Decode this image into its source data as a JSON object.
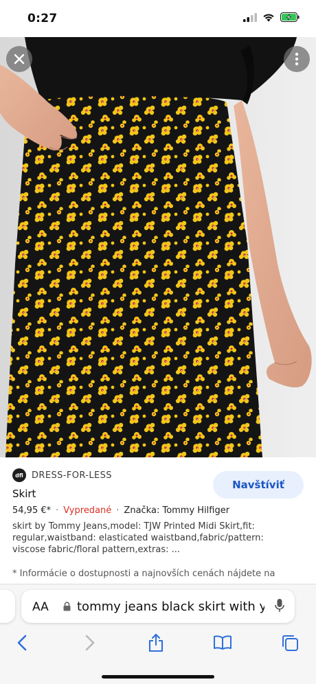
{
  "status_bar": {
    "time": "0:27",
    "icons": [
      "cellular-signal-icon",
      "wifi-icon",
      "battery-charging-icon"
    ]
  },
  "image_viewer": {
    "close_icon": "close-icon",
    "more_icon": "more-vertical-icon",
    "image_alt": "Black midi skirt with yellow floral print"
  },
  "result": {
    "source_logo_text": "dfl",
    "source_name": "DRESS-FOR-LESS",
    "visit_label": "Navštíviť",
    "title": "Skirt",
    "price": "54,95 €*",
    "separator": "·",
    "availability": "Vypredané",
    "brand": "Značka: Tommy Hilfiger",
    "description": "skirt by Tommy Jeans,model: TJW Printed Midi Skirt,fit: regular,waistband: elasticated waistband,fabric/pattern: viscose fabric/floral pattern,extras: ...",
    "note": "* Informácie o dostupnosti a najnovších cenách nájdete na"
  },
  "browser": {
    "aa_label": "AA",
    "search_text": "tommy jeans black skirt with y",
    "nav_icons": [
      "back-icon",
      "forward-icon",
      "share-icon",
      "bookmarks-icon",
      "tabs-icon"
    ]
  },
  "colors": {
    "accent_blue": "#1a56c4",
    "sold_out_red": "#d93025",
    "visit_button_bg": "#e8effd"
  }
}
